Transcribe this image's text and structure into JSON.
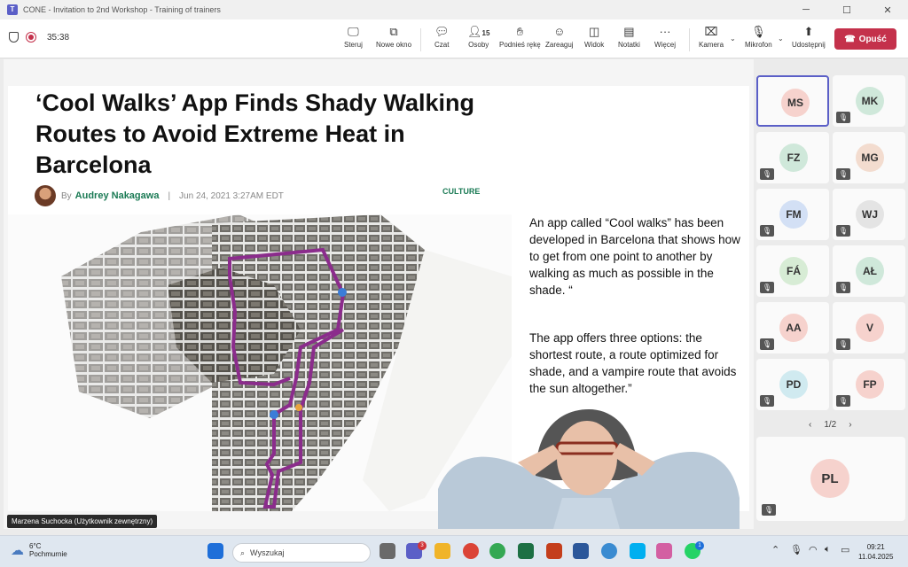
{
  "window": {
    "title": "CONE - Invitation to 2nd Workshop - Training of trainers"
  },
  "toolbar": {
    "timer": "35:38",
    "buttons": [
      {
        "label": "Steruj",
        "icon": "share-screen-icon"
      },
      {
        "label": "Nowe okno",
        "icon": "new-window-icon"
      },
      {
        "label": "Czat",
        "icon": "chat-icon"
      },
      {
        "label": "Osoby",
        "icon": "people-icon",
        "count": "15"
      },
      {
        "label": "Podnieś rękę",
        "icon": "raise-hand-icon"
      },
      {
        "label": "Zareaguj",
        "icon": "react-icon"
      },
      {
        "label": "Widok",
        "icon": "view-icon"
      },
      {
        "label": "Notatki",
        "icon": "notes-icon"
      },
      {
        "label": "Więcej",
        "icon": "more-icon"
      },
      {
        "label": "Kamera",
        "icon": "camera-off-icon"
      },
      {
        "label": "Mikrofon",
        "icon": "mic-off-icon"
      },
      {
        "label": "Udostępnij",
        "icon": "share-icon"
      }
    ],
    "leave_label": "Opuść"
  },
  "slide": {
    "headline": "‘Cool Walks’ App Finds Shady Walking Routes to Avoid Extreme Heat in Barcelona",
    "by": "By",
    "author": "Audrey Nakagawa",
    "divider": "|",
    "date": "Jun 24, 2021 3:27AM EDT",
    "category": "CULTURE",
    "paragraph1": "An app called “Cool walks” has been developed in Barcelona that shows how to get from one point to another by walking as much as possible in the shade. “",
    "paragraph2": "The app offers three options: the shortest route, a route optimized for shade, and a vampire route that avoids the sun altogether.”"
  },
  "presenter": {
    "name": "Marzena Suchocka (Użytkownik zewnętrzny)"
  },
  "participants": [
    {
      "initials": "MS",
      "bg": "#f6d2cd",
      "active": true,
      "muted": false
    },
    {
      "initials": "MK",
      "bg": "#cfe8da",
      "active": false,
      "muted": true
    },
    {
      "initials": "FZ",
      "bg": "#cfe8da",
      "active": false,
      "muted": true
    },
    {
      "initials": "MG",
      "bg": "#f3dccf",
      "active": false,
      "muted": true
    },
    {
      "initials": "FM",
      "bg": "#d3e0f5",
      "active": false,
      "muted": true
    },
    {
      "initials": "WJ",
      "bg": "#e4e4e4",
      "active": false,
      "muted": true
    },
    {
      "initials": "FÁ",
      "bg": "#d7ecd5",
      "active": false,
      "muted": true
    },
    {
      "initials": "AŁ",
      "bg": "#cfe8da",
      "active": false,
      "muted": true
    },
    {
      "initials": "AA",
      "bg": "#f6d2cd",
      "active": false,
      "muted": true
    },
    {
      "initials": "V",
      "bg": "#f6d2cd",
      "active": false,
      "muted": true
    },
    {
      "initials": "PD",
      "bg": "#d0eaf0",
      "active": false,
      "muted": true
    },
    {
      "initials": "FP",
      "bg": "#f6d2cd",
      "active": false,
      "muted": true
    }
  ],
  "pager": {
    "prev": "‹",
    "label": "1/2",
    "next": "›"
  },
  "featured": {
    "initials": "PL"
  },
  "taskbar": {
    "temp": "6°C",
    "condition": "Pochmurnie",
    "search_placeholder": "Wyszukaj",
    "teams_badge": "3",
    "whatsapp_badge": "1",
    "time": "09:21",
    "date": "11.04.2025"
  },
  "colors": {
    "accent": "#5b5fc7",
    "leave": "#c4314b",
    "route": "#8b2c8c",
    "category": "#1a7a54"
  }
}
